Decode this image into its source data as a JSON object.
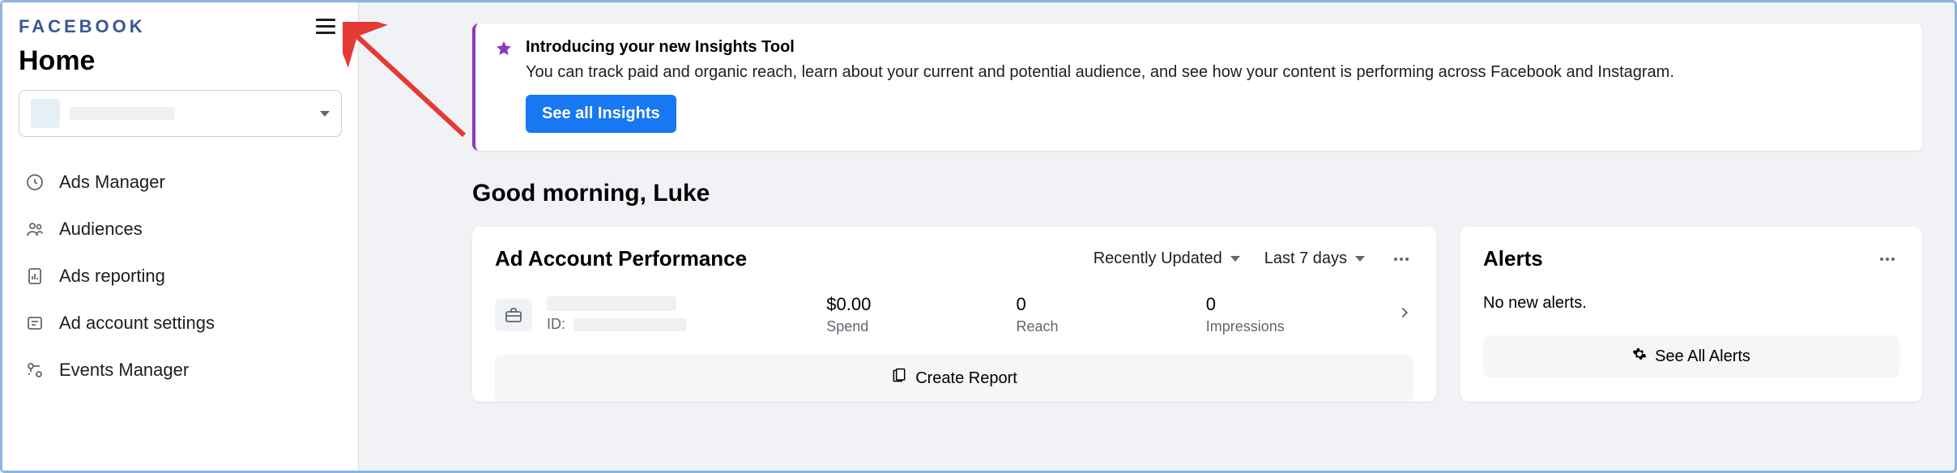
{
  "brand": "FACEBOOK",
  "page_title": "Home",
  "sidebar": {
    "items": [
      {
        "label": "Ads Manager"
      },
      {
        "label": "Audiences"
      },
      {
        "label": "Ads reporting"
      },
      {
        "label": "Ad account settings"
      },
      {
        "label": "Events Manager"
      }
    ]
  },
  "banner": {
    "title": "Introducing your new Insights Tool",
    "text": "You can track paid and organic reach, learn about your current and potential audience, and see how your content is performing across Facebook and Instagram.",
    "cta": "See all Insights"
  },
  "greeting": "Good morning, Luke",
  "performance": {
    "title": "Ad Account Performance",
    "sort": "Recently Updated",
    "range": "Last 7 days",
    "account": {
      "id_label": "ID:"
    },
    "metrics": [
      {
        "value": "$0.00",
        "label": "Spend"
      },
      {
        "value": "0",
        "label": "Reach"
      },
      {
        "value": "0",
        "label": "Impressions"
      }
    ],
    "create_report": "Create Report"
  },
  "alerts": {
    "title": "Alerts",
    "empty": "No new alerts.",
    "cta": "See All Alerts"
  }
}
